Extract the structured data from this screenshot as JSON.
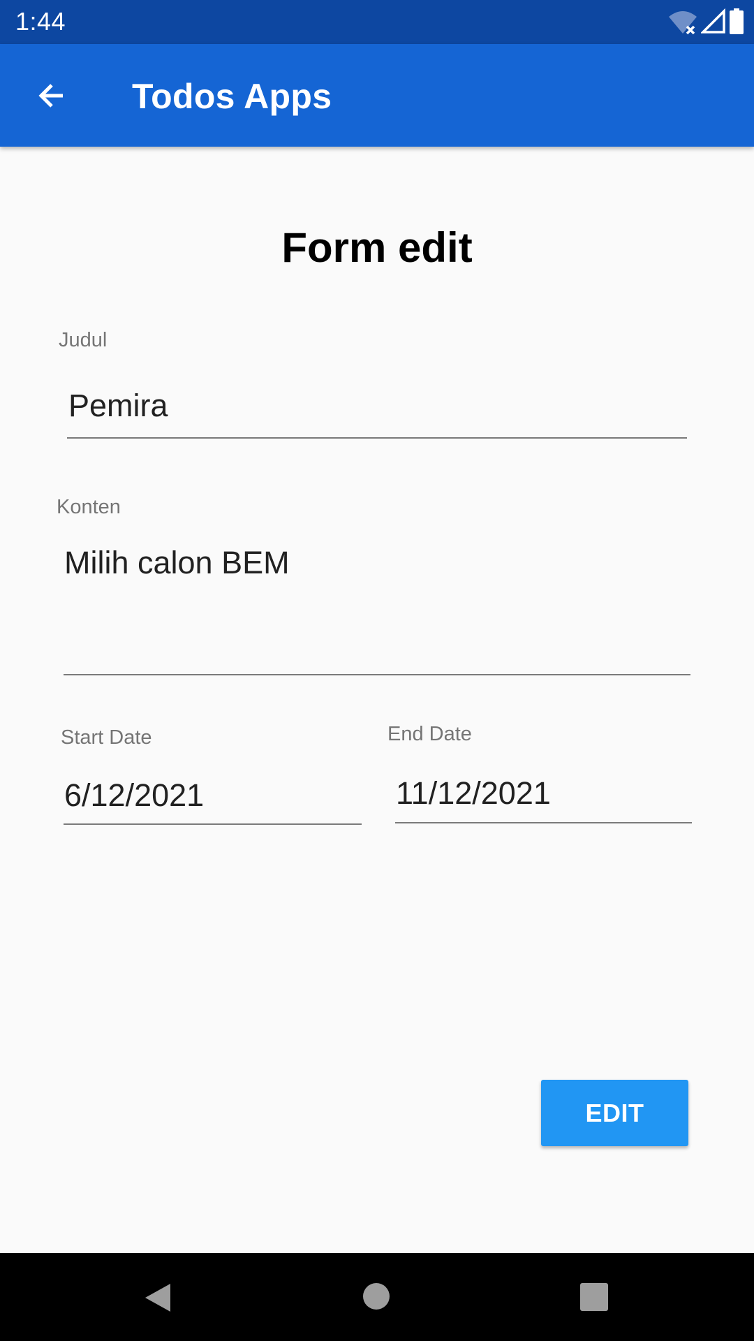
{
  "status_bar": {
    "time": "1:44",
    "icons": [
      "wifi-off-icon",
      "signal-icon",
      "battery-icon"
    ]
  },
  "app_bar": {
    "title": "Todos Apps",
    "back_icon": "arrow-left-icon",
    "color": "#1565d4"
  },
  "form": {
    "title": "Form edit",
    "judul": {
      "label": "Judul",
      "value": "Pemira"
    },
    "konten": {
      "label": "Konten",
      "value": "Milih calon BEM"
    },
    "start_date": {
      "label": "Start Date",
      "value": "6/12/2021"
    },
    "end_date": {
      "label": "End Date",
      "value": "11/12/2021"
    },
    "edit_label": "EDIT",
    "button_color": "#2196f3"
  },
  "nav_bar": {
    "buttons": [
      "back-triangle-icon",
      "home-circle-icon",
      "recents-square-icon"
    ]
  }
}
